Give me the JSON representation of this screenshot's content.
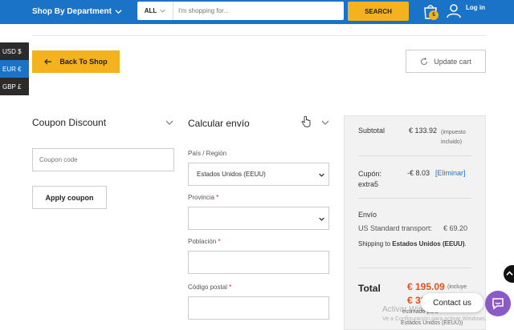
{
  "header": {
    "department": "Shop By Department",
    "search_category": "ALL",
    "search_placeholder": "I'm shopping for...",
    "search_button": "SEARCH",
    "cart_count": "5",
    "login": "Log in"
  },
  "currencies": [
    "USD $",
    "EUR €",
    "GBP £"
  ],
  "actions": {
    "back": "Back To Shop",
    "update": "Update cart"
  },
  "coupon": {
    "title": "Coupon Discount",
    "placeholder": "Coupon code",
    "apply": "Apply coupon"
  },
  "shipping_calc": {
    "title": "Calcular envío",
    "country_label": "País / Región",
    "country_value": "Estados Unidos (EEUU)",
    "state_label": "Provincia",
    "city_label": "Población",
    "postcode_label": "Código postal",
    "required_mark": "*"
  },
  "totals": {
    "subtotal_label": "Subtotal",
    "subtotal_value": "€ 133.92",
    "subtotal_note": "(impuesto incluido)",
    "coupon_label": "Cupón: extra5",
    "coupon_value": "-€ 8.03",
    "coupon_remove": "[Eliminar]",
    "shipping_label": "Envío",
    "shipping_method": "US Standard transport:",
    "shipping_amount": "€ 69.20",
    "shipping_to_text": "Shipping to",
    "shipping_to_country": "Estados Unidos (EEUU)",
    "total_label": "Total",
    "total_value": "€ 195.09",
    "total_note": "(incluye",
    "total_value_partial": "€ 32",
    "total_note2": "estimado para",
    "total_note3": "Estados Unidos (EEUU))"
  },
  "widgets": {
    "contact": "Contact us",
    "watermark_line1": "Activar Windows",
    "watermark_line2": "Ve a Configuración para activar Windows."
  },
  "colors": {
    "brand_blue": "#1a73c6",
    "accent_yellow": "#f5b21f",
    "price_red": "#e8501b",
    "contact_purple": "#8a5ac8"
  }
}
